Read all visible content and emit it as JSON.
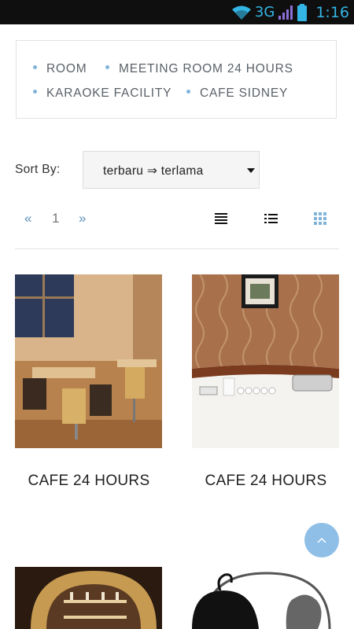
{
  "status_bar": {
    "network": "3G",
    "time": "1:16"
  },
  "categories": [
    "ROOM",
    "MEETING ROOM 24 HOURS",
    "KARAOKE FACILITY",
    "CAFE SIDNEY"
  ],
  "sort": {
    "label": "Sort By:",
    "selected": "terbaru ⇒ terlama"
  },
  "pagination": {
    "prev": "«",
    "page": "1",
    "next": "»"
  },
  "view_modes": {
    "icons": [
      "list-view-icon",
      "detailed-list-icon",
      "grid-view-icon"
    ],
    "active": "grid-view-icon"
  },
  "products": [
    {
      "title": "CAFE 24 HOURS"
    },
    {
      "title": "CAFE 24 HOURS"
    }
  ],
  "colors": {
    "accent": "#7fb3da",
    "status_bar": "#0f0f0f",
    "status_icon": "#33b5e5",
    "to_top": "#8fbfe7"
  }
}
